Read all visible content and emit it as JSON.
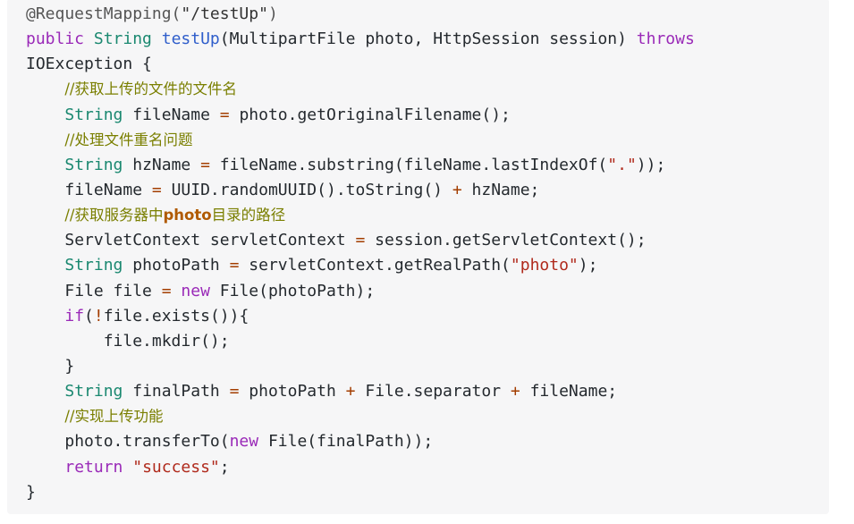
{
  "code_block": {
    "lines": [
      {
        "indent": "",
        "tokens": [
          {
            "t": "@RequestMapping(",
            "c": "ann"
          },
          {
            "t": "\"/testUp\"",
            "c": "ann-str"
          },
          {
            "t": ")",
            "c": "ann"
          }
        ]
      },
      {
        "indent": "",
        "tokens": [
          {
            "t": "public",
            "c": "kw"
          },
          {
            "t": " ",
            "c": "plain"
          },
          {
            "t": "String",
            "c": "type"
          },
          {
            "t": " ",
            "c": "plain"
          },
          {
            "t": "testUp",
            "c": "fn"
          },
          {
            "t": "(MultipartFile photo, HttpSession session) ",
            "c": "plain"
          },
          {
            "t": "throws",
            "c": "kw"
          }
        ]
      },
      {
        "indent": "",
        "tokens": [
          {
            "t": "IOException {",
            "c": "plain"
          }
        ]
      },
      {
        "indent": "    ",
        "tokens": [
          {
            "t": "//获取上传的文件的文件名",
            "c": "cm"
          }
        ]
      },
      {
        "indent": "    ",
        "tokens": [
          {
            "t": "String",
            "c": "type"
          },
          {
            "t": " fileName ",
            "c": "plain"
          },
          {
            "t": "=",
            "c": "op"
          },
          {
            "t": " photo.getOriginalFilename();",
            "c": "plain"
          }
        ]
      },
      {
        "indent": "    ",
        "tokens": [
          {
            "t": "//处理文件重名问题",
            "c": "cm"
          }
        ]
      },
      {
        "indent": "    ",
        "tokens": [
          {
            "t": "String",
            "c": "type"
          },
          {
            "t": " hzName ",
            "c": "plain"
          },
          {
            "t": "=",
            "c": "op"
          },
          {
            "t": " fileName.substring(fileName.lastIndexOf(",
            "c": "plain"
          },
          {
            "t": "\".\"",
            "c": "str"
          },
          {
            "t": "));",
            "c": "plain"
          }
        ]
      },
      {
        "indent": "    ",
        "tokens": [
          {
            "t": "fileName ",
            "c": "plain"
          },
          {
            "t": "=",
            "c": "op"
          },
          {
            "t": " UUID.randomUUID().toString() ",
            "c": "plain"
          },
          {
            "t": "+",
            "c": "op"
          },
          {
            "t": " hzName;",
            "c": "plain"
          }
        ]
      },
      {
        "indent": "    ",
        "tokens": [
          {
            "t": "//获取服务器中",
            "c": "cm"
          },
          {
            "t": "photo",
            "c": "cm-hl"
          },
          {
            "t": "目录的路径",
            "c": "cm"
          }
        ]
      },
      {
        "indent": "    ",
        "tokens": [
          {
            "t": "ServletContext servletContext ",
            "c": "plain"
          },
          {
            "t": "=",
            "c": "op"
          },
          {
            "t": " session.getServletContext();",
            "c": "plain"
          }
        ]
      },
      {
        "indent": "    ",
        "tokens": [
          {
            "t": "String",
            "c": "type"
          },
          {
            "t": " photoPath ",
            "c": "plain"
          },
          {
            "t": "=",
            "c": "op"
          },
          {
            "t": " servletContext.getRealPath(",
            "c": "plain"
          },
          {
            "t": "\"photo\"",
            "c": "str"
          },
          {
            "t": ");",
            "c": "plain"
          }
        ]
      },
      {
        "indent": "    ",
        "tokens": [
          {
            "t": "File file ",
            "c": "plain"
          },
          {
            "t": "=",
            "c": "op"
          },
          {
            "t": " ",
            "c": "plain"
          },
          {
            "t": "new",
            "c": "kw"
          },
          {
            "t": " File(photoPath);",
            "c": "plain"
          }
        ]
      },
      {
        "indent": "    ",
        "tokens": [
          {
            "t": "if",
            "c": "kw"
          },
          {
            "t": "(",
            "c": "plain"
          },
          {
            "t": "!",
            "c": "op"
          },
          {
            "t": "file.exists()){",
            "c": "plain"
          }
        ]
      },
      {
        "indent": "        ",
        "tokens": [
          {
            "t": "file.mkdir();",
            "c": "plain"
          }
        ]
      },
      {
        "indent": "    ",
        "tokens": [
          {
            "t": "}",
            "c": "plain"
          }
        ]
      },
      {
        "indent": "    ",
        "tokens": [
          {
            "t": "String",
            "c": "type"
          },
          {
            "t": " finalPath ",
            "c": "plain"
          },
          {
            "t": "=",
            "c": "op"
          },
          {
            "t": " photoPath ",
            "c": "plain"
          },
          {
            "t": "+",
            "c": "op"
          },
          {
            "t": " File.separator ",
            "c": "plain"
          },
          {
            "t": "+",
            "c": "op"
          },
          {
            "t": " fileName;",
            "c": "plain"
          }
        ]
      },
      {
        "indent": "    ",
        "tokens": [
          {
            "t": "//实现上传功能",
            "c": "cm"
          }
        ]
      },
      {
        "indent": "    ",
        "tokens": [
          {
            "t": "photo.transferTo(",
            "c": "plain"
          },
          {
            "t": "new",
            "c": "kw"
          },
          {
            "t": " File(finalPath));",
            "c": "plain"
          }
        ]
      },
      {
        "indent": "    ",
        "tokens": [
          {
            "t": "return",
            "c": "kw"
          },
          {
            "t": " ",
            "c": "plain"
          },
          {
            "t": "\"success\"",
            "c": "str"
          },
          {
            "t": ";",
            "c": "plain"
          }
        ]
      },
      {
        "indent": "",
        "tokens": [
          {
            "t": "}",
            "c": "plain"
          }
        ]
      }
    ]
  }
}
